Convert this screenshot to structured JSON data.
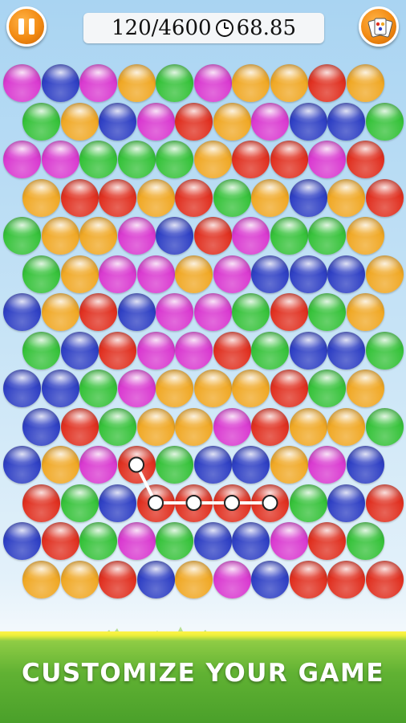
{
  "hud": {
    "score": "120/4600",
    "timer": "68.85",
    "pause_icon": "pause-icon",
    "cards_icon": "playing-cards-icon",
    "clock_icon": "clock-icon"
  },
  "colors": {
    "magenta": "#d93ad0",
    "blue": "#2f40c4",
    "orange": "#f0a825",
    "green": "#36c23a",
    "red": "#e03020"
  },
  "board": {
    "rows": [
      [
        "magenta",
        "blue",
        "magenta",
        "orange",
        "green",
        "magenta",
        "orange",
        "orange",
        "red",
        "orange"
      ],
      [
        "green",
        "orange",
        "blue",
        "magenta",
        "red",
        "orange",
        "magenta",
        "blue",
        "blue",
        "green"
      ],
      [
        "magenta",
        "magenta",
        "green",
        "green",
        "green",
        "orange",
        "red",
        "red",
        "magenta",
        "red"
      ],
      [
        "orange",
        "red",
        "red",
        "orange",
        "red",
        "green",
        "orange",
        "blue",
        "orange",
        "red"
      ],
      [
        "green",
        "orange",
        "orange",
        "magenta",
        "blue",
        "red",
        "magenta",
        "green",
        "green",
        "orange"
      ],
      [
        "green",
        "orange",
        "magenta",
        "magenta",
        "orange",
        "magenta",
        "blue",
        "blue",
        "blue",
        "orange"
      ],
      [
        "blue",
        "orange",
        "red",
        "blue",
        "magenta",
        "magenta",
        "green",
        "red",
        "green",
        "orange"
      ],
      [
        "green",
        "blue",
        "red",
        "magenta",
        "magenta",
        "red",
        "green",
        "blue",
        "blue",
        "green"
      ],
      [
        "blue",
        "blue",
        "green",
        "magenta",
        "orange",
        "orange",
        "orange",
        "red",
        "green",
        "orange"
      ],
      [
        "blue",
        "red",
        "green",
        "orange",
        "orange",
        "magenta",
        "red",
        "orange",
        "orange",
        "green"
      ],
      [
        "blue",
        "orange",
        "magenta",
        "red",
        "green",
        "blue",
        "blue",
        "orange",
        "magenta",
        "blue"
      ],
      [
        "red",
        "green",
        "blue",
        "red",
        "red",
        "red",
        "red",
        "green",
        "blue",
        "red"
      ],
      [
        "blue",
        "red",
        "green",
        "magenta",
        "green",
        "blue",
        "blue",
        "magenta",
        "red",
        "green"
      ],
      [
        "orange",
        "orange",
        "red",
        "blue",
        "orange",
        "magenta",
        "blue",
        "red",
        "red",
        "red"
      ]
    ],
    "selected_path": [
      [
        10,
        3
      ],
      [
        11,
        3
      ],
      [
        11,
        4
      ],
      [
        11,
        5
      ],
      [
        11,
        6
      ]
    ]
  },
  "caption": "CUSTOMIZE YOUR GAME"
}
